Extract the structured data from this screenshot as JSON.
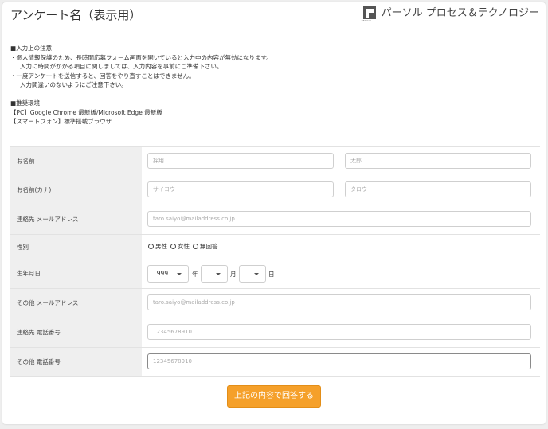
{
  "header": {
    "title": "アンケート名（表示用）",
    "logo_text": "パーソル プロセス＆テクノロジー",
    "logo_small": "PERSOL"
  },
  "notice": {
    "heading1": "■入力上の注意",
    "line1": "・個人情報保護のため、長時間応募フォーム画面を開いていると入力中の内容が無効になります。",
    "line2": "入力に時間がかかる項目に関しましては、入力内容を事前にご準備下さい。",
    "line3": "・一度アンケートを送信すると、回答をやり直すことはできません。",
    "line4": "入力間違いのないようにご注意下さい。",
    "heading2": "■推奨環境",
    "env_pc": "【PC】Google Chrome 最新版/Microsoft Edge 最新版",
    "env_sp": "【スマートフォン】標準搭載ブラウザ"
  },
  "form": {
    "name_label": "お名前",
    "name_last_placeholder": "採用",
    "name_first_placeholder": "太郎",
    "kana_label": "お名前(カナ)",
    "kana_last_placeholder": "サイヨウ",
    "kana_first_placeholder": "タロウ",
    "email_label": "連絡先 メールアドレス",
    "email_placeholder": "taro.saiyo@mailaddress.co.jp",
    "gender_label": "性別",
    "gender_options": [
      "男性",
      "女性",
      "無回答"
    ],
    "birth_label": "生年月日",
    "birth_year": "1999",
    "birth_month": "",
    "birth_day": "",
    "year_unit": "年",
    "month_unit": "月",
    "day_unit": "日",
    "other_email_label": "その他 メールアドレス",
    "other_email_placeholder": "taro.saiyo@mailaddress.co.jp",
    "phone_label": "連絡先 電話番号",
    "phone_placeholder": "12345678910",
    "other_phone_label": "その他 電話番号",
    "other_phone_placeholder": "12345678910"
  },
  "submit_label": "上記の内容で回答する",
  "colors": {
    "accent": "#f5a02a",
    "label_bg": "#efefef",
    "page_bg": "#eeeeee"
  }
}
